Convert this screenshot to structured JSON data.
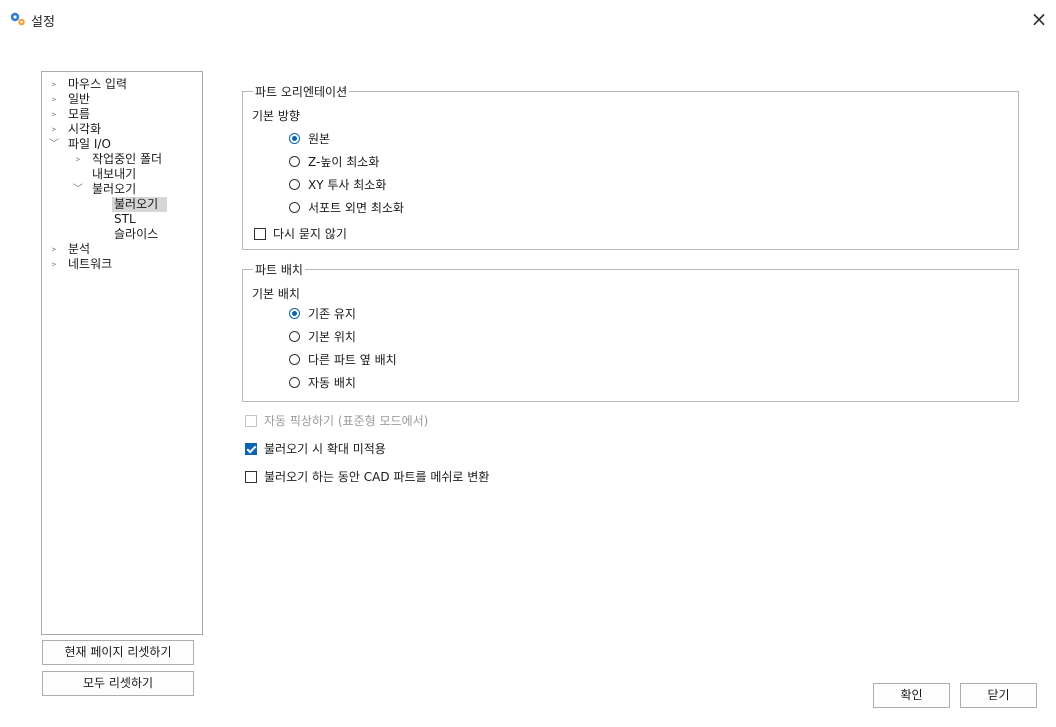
{
  "window": {
    "title": "설정",
    "close_glyph": "×",
    "icon": "gear-pair-icon",
    "accent_color": "#0a64b3"
  },
  "tree": {
    "items": [
      {
        "label": "마우스 입력",
        "arrow": "﹥"
      },
      {
        "label": "일반",
        "arrow": "﹥"
      },
      {
        "label": "모름",
        "arrow": "﹥"
      },
      {
        "label": "시각화",
        "arrow": "﹥"
      },
      {
        "label": "파일 I/O",
        "arrow": "﹀"
      },
      {
        "label": "작업중인 폴더",
        "arrow": "﹥"
      },
      {
        "label": "내보내기"
      },
      {
        "label": "불러오기",
        "arrow": "﹀"
      },
      {
        "label": "불러오기",
        "selected": true
      },
      {
        "label": "STL"
      },
      {
        "label": "슬라이스"
      },
      {
        "label": "분석",
        "arrow": "﹥"
      },
      {
        "label": "네트워크",
        "arrow": "﹥"
      }
    ]
  },
  "buttons": {
    "reset_page": "현재 페이지 리셋하기",
    "reset_all": "모두 리셋하기",
    "ok": "확인",
    "close": "닫기"
  },
  "orientation": {
    "title": "파트 오리엔테이션",
    "subtitle": "기본 방향",
    "options": [
      "원본",
      "Z-높이 최소화",
      "XY 투사 최소화",
      "서포트 외면 최소화"
    ],
    "selected_index": 0,
    "dont_ask_label": "다시 묻지 않기",
    "dont_ask_checked": false
  },
  "placement": {
    "title": "파트 배치",
    "subtitle": "기본 배치",
    "options": [
      "기존 유지",
      "기본 위치",
      "다른 파트 옆 배치",
      "자동 배치"
    ],
    "selected_index": 0
  },
  "options": {
    "auto_fix_label": "자동 픽상하기 (표준형 모드에서)",
    "auto_fix_checked": false,
    "auto_fix_disabled": true,
    "no_scale_label": "불러오기 시 확대 미적용",
    "no_scale_checked": true,
    "cad_mesh_label": "불러오기 하는 동안 CAD 파트를 메쉬로 변환",
    "cad_mesh_checked": false
  }
}
